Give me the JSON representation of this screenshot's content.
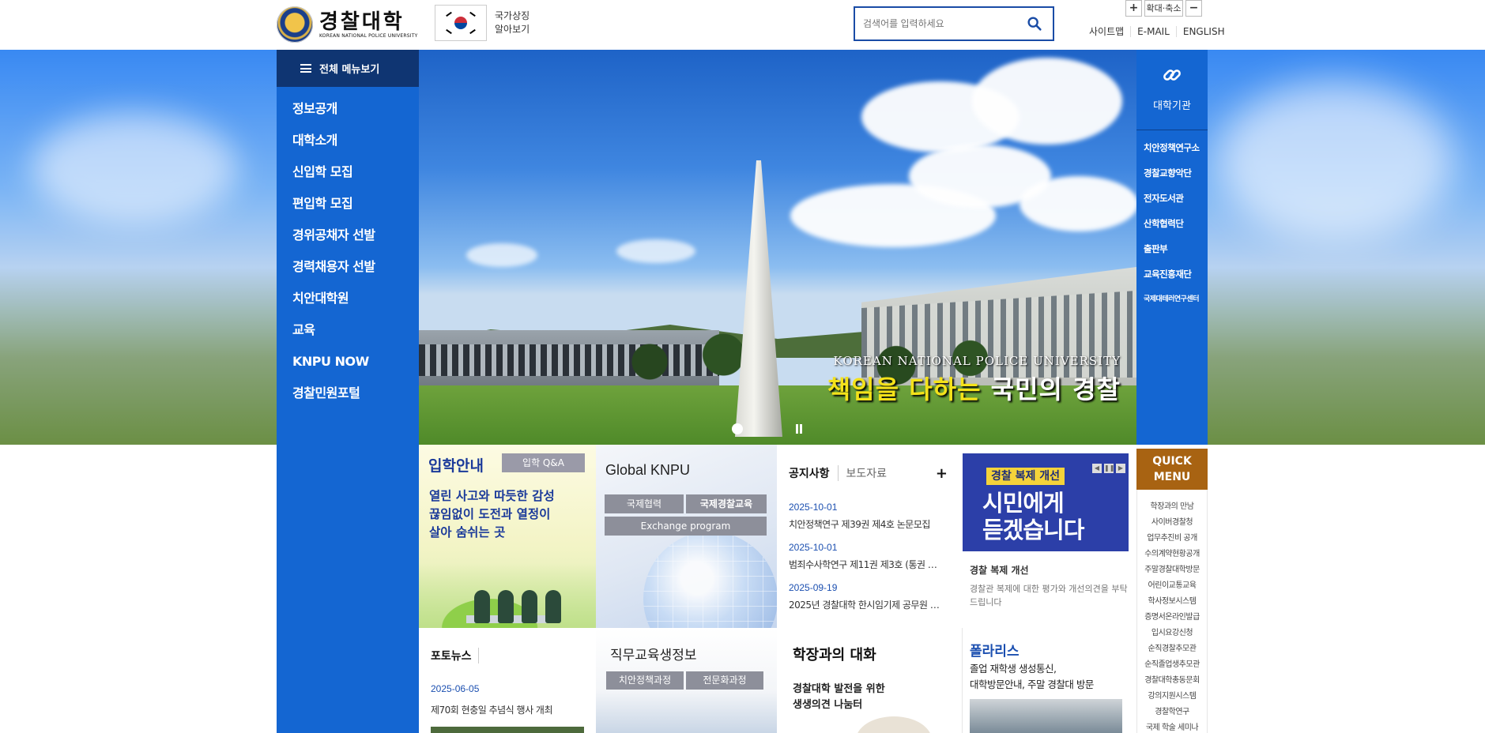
{
  "header": {
    "logo_ko": "경찰대학",
    "logo_en": "KOREAN NATIONAL POLICE UNIVERSITY",
    "symbol_line1": "국가상징",
    "symbol_line2": "알아보기",
    "search_placeholder": "검색어를 입력하세요",
    "zoom_plus": "+",
    "zoom_label": "확대·축소",
    "zoom_minus": "−",
    "util_links": [
      "사이트맵",
      "E-MAIL",
      "ENGLISH"
    ]
  },
  "leftnav": {
    "all_menu": "전체 메뉴보기",
    "items": [
      "정보공개",
      "대학소개",
      "신입학 모집",
      "편입학 모집",
      "경위공채자 선발",
      "경력채용자 선발",
      "치안대학원",
      "교육",
      "KNPU NOW",
      "경찰민원포털"
    ]
  },
  "banner": {
    "en_text": "KOREAN NATIONAL POLICE UNIVERSITY",
    "ko_highlight": "책임을 다하는",
    "ko_rest": " 국민의 경찰"
  },
  "orgs": {
    "title": "대학기관",
    "items": [
      "치안정책연구소",
      "경찰교향악단",
      "전자도서관",
      "산학협력단",
      "출판부",
      "교육진흥재단",
      "국제대테러연구센터"
    ]
  },
  "admission": {
    "title": "입학안내",
    "qa_button": "입학 Q&A",
    "text_line1": "열린 사고와 따듯한 감성",
    "text_line2": "끊임없이 도전과 열정이",
    "text_line3": "살아 숨쉬는 곳"
  },
  "global": {
    "title": "Global KNPU",
    "btn1": "국제협력",
    "btn2": "국제경찰교육",
    "btn3": "Exchange program"
  },
  "notice": {
    "tab_active": "공지사항",
    "tab_inactive": "보도자료",
    "more": "+",
    "items": [
      {
        "date": "2025-10-01",
        "title": "치안정책연구 제39권 제4호 논문모집"
      },
      {
        "date": "2025-10-01",
        "title": "범죄수사학연구 제11권 제3호 (통권 …"
      },
      {
        "date": "2025-09-19",
        "title": "2025년 경찰대학 한시임기제 공무원 …"
      }
    ]
  },
  "welfare": {
    "badge": "경찰 복제 개선",
    "big_line1": "시민에게",
    "big_line2": "듣겠습니다",
    "title": "경찰 복제 개선",
    "desc": "경찰관 복제에 대한 평가와 개선의견을 부탁드립니다"
  },
  "quick": {
    "title_line1": "QUICK",
    "title_line2": "MENU",
    "items": [
      "학장과의 만남",
      "사이버경찰청",
      "업무추진비 공개",
      "수의계약현황공개",
      "주말경찰대학방문",
      "어린이교통교육",
      "학사정보시스템",
      "증명서온라인발급",
      "입시요강신청",
      "순직경찰추모관",
      "순직졸업생추모관",
      "경찰대학총동문회",
      "강의지원시스템",
      "경찰학연구",
      "국제 학술 세미나"
    ]
  },
  "photo": {
    "title": "포토뉴스",
    "date": "2025-06-05",
    "desc": "제70회 현충일 추념식 행사 개최"
  },
  "job": {
    "title": "직무교육생정보",
    "btn1": "치안정책과정",
    "btn2": "전문화과정"
  },
  "dialog": {
    "title": "학장과의 대화",
    "sub_line1": "경찰대학 발전을 위한",
    "sub_line2": "생생의견 나눔터"
  },
  "polaris": {
    "title": "폴라리스",
    "desc_line1": "졸업 재학생 생성통신,",
    "desc_line2": "대학방문안내, 주말 경찰대 방문"
  }
}
